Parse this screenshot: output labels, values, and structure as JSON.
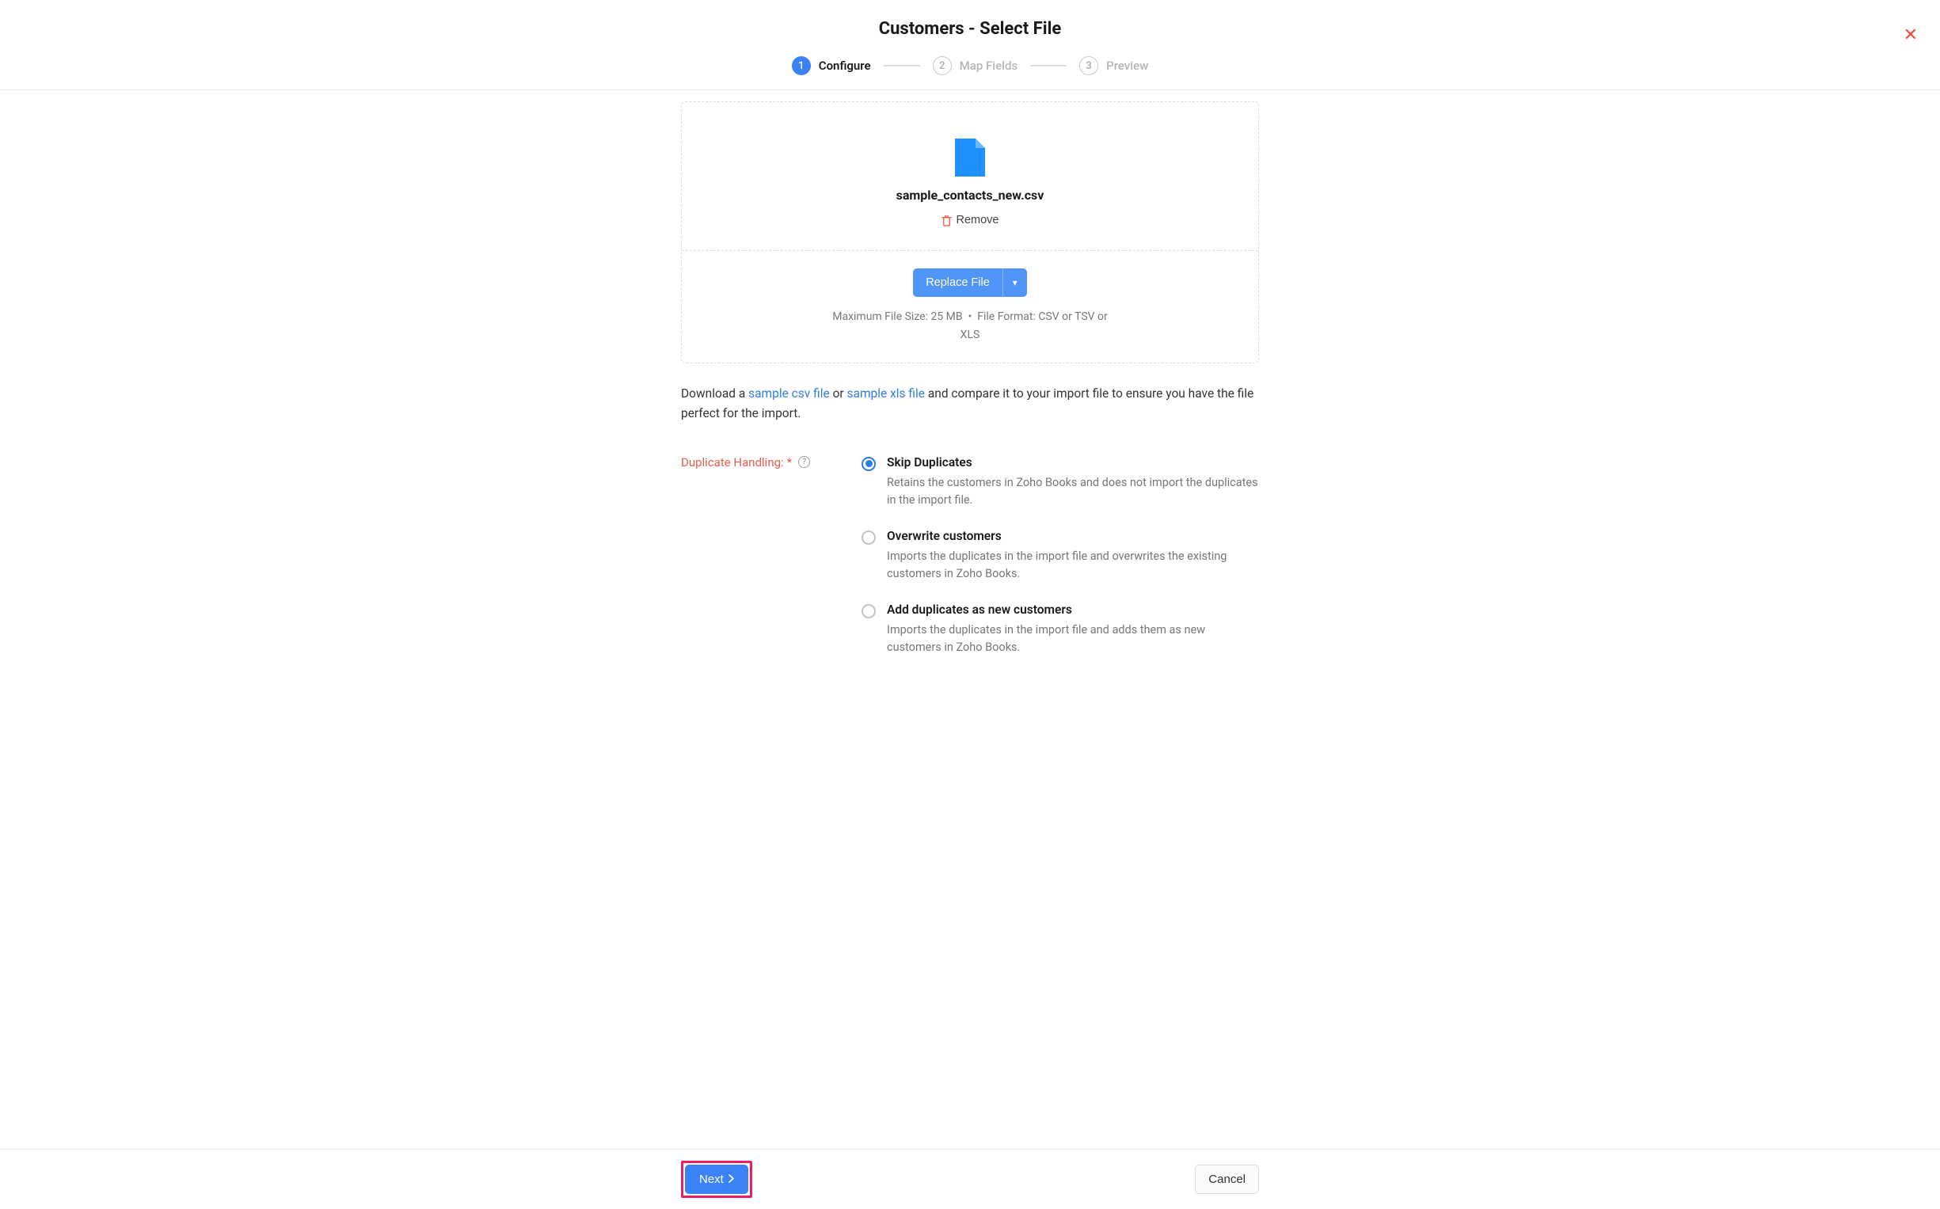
{
  "header": {
    "title": "Customers - Select File"
  },
  "stepper": {
    "steps": [
      {
        "num": "1",
        "label": "Configure"
      },
      {
        "num": "2",
        "label": "Map Fields"
      },
      {
        "num": "3",
        "label": "Preview"
      }
    ]
  },
  "file": {
    "name": "sample_contacts_new.csv",
    "remove_label": "Remove",
    "replace_label": "Replace File",
    "hint_prefix": "Maximum File Size: 25 MB",
    "hint_bullet": "•",
    "hint_format": "File Format: CSV or TSV or XLS"
  },
  "sample": {
    "prefix": "Download a ",
    "csv_link": "sample csv file",
    "or": " or ",
    "xls_link": "sample xls file",
    "suffix": " and compare it to your import file to ensure you have the file perfect for the import."
  },
  "dup": {
    "label": "Duplicate Handling:",
    "required": "*",
    "options": [
      {
        "title": "Skip Duplicates",
        "desc": "Retains the customers in Zoho Books and does not import the duplicates in the import file.",
        "selected": true
      },
      {
        "title": "Overwrite customers",
        "desc": "Imports the duplicates in the import file and overwrites the existing customers in Zoho Books.",
        "selected": false
      },
      {
        "title": "Add duplicates as new customers",
        "desc": "Imports the duplicates in the import file and adds them as new customers in Zoho Books.",
        "selected": false
      }
    ]
  },
  "footer": {
    "next": "Next",
    "cancel": "Cancel"
  }
}
